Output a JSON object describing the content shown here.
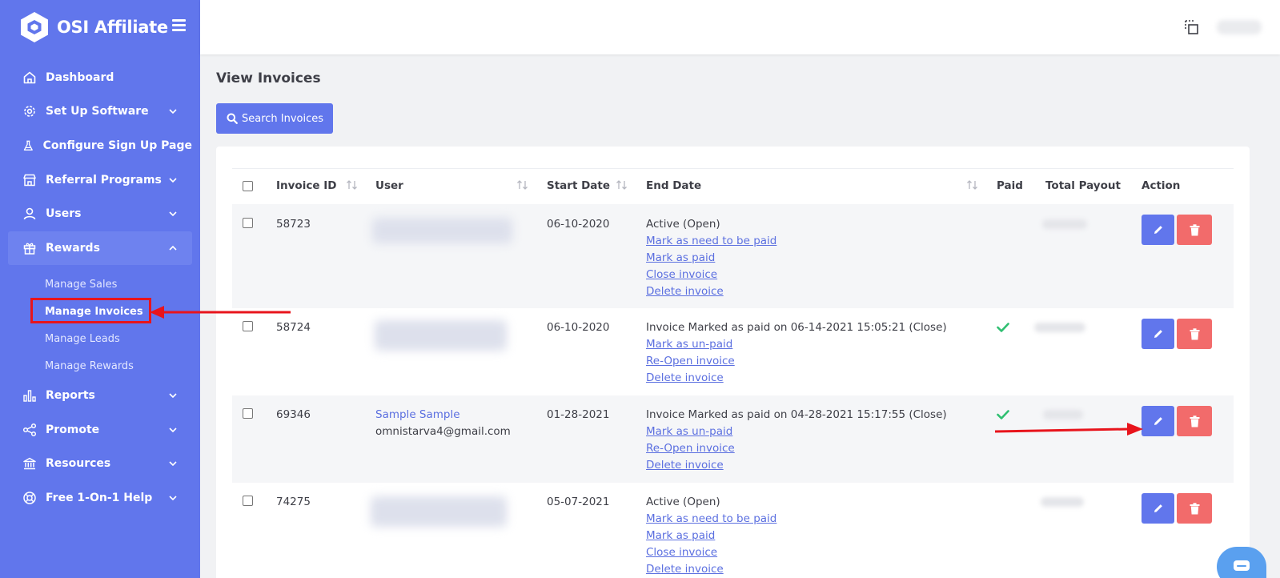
{
  "brand": {
    "name": "OSI Affiliate"
  },
  "sidebar": {
    "items": [
      {
        "label": "Dashboard",
        "icon": "home-icon",
        "chevron": false
      },
      {
        "label": "Set Up Software",
        "icon": "gear-icon",
        "chevron": true
      },
      {
        "label": "Configure Sign Up Page",
        "icon": "flask-icon",
        "chevron": false
      },
      {
        "label": "Referral Programs",
        "icon": "store-icon",
        "chevron": true
      },
      {
        "label": "Users",
        "icon": "user-icon",
        "chevron": true
      },
      {
        "label": "Rewards",
        "icon": "gift-icon",
        "chevron": true,
        "expanded": true
      },
      {
        "label": "Reports",
        "icon": "bar-chart-icon",
        "chevron": true
      },
      {
        "label": "Promote",
        "icon": "share-icon",
        "chevron": true
      },
      {
        "label": "Resources",
        "icon": "bank-icon",
        "chevron": true
      },
      {
        "label": "Free 1-On-1 Help",
        "icon": "lifebuoy-icon",
        "chevron": true
      }
    ],
    "rewards_sub": [
      {
        "label": "Manage Sales"
      },
      {
        "label": "Manage Invoices",
        "current": true
      },
      {
        "label": "Manage Leads"
      },
      {
        "label": "Manage Rewards"
      }
    ]
  },
  "page": {
    "title": "View Invoices",
    "search_button": "Search Invoices"
  },
  "table": {
    "headers": [
      "Invoice ID",
      "User",
      "Start Date",
      "End Date",
      "Paid",
      "Total Payout",
      "Action"
    ],
    "rows": [
      {
        "id": "58723",
        "user_name": "",
        "user_email": "",
        "start": "06-10-2020",
        "status": "Active (Open)",
        "paid": false,
        "links": [
          "Mark as need to be paid",
          "Mark as paid",
          "Close invoice",
          "Delete invoice"
        ]
      },
      {
        "id": "58724",
        "user_name": "",
        "user_email": "",
        "start": "06-10-2020",
        "status": "Invoice Marked as paid on 06-14-2021 15:05:21 (Close)",
        "paid": true,
        "links": [
          "Mark as un-paid",
          "Re-Open invoice",
          "Delete invoice"
        ]
      },
      {
        "id": "69346",
        "user_name": "Sample Sample",
        "user_email": "omnistarva4@gmail.com",
        "start": "01-28-2021",
        "status": "Invoice Marked as paid on 04-28-2021 15:17:55 (Close)",
        "paid": true,
        "links": [
          "Mark as un-paid",
          "Re-Open invoice",
          "Delete invoice"
        ]
      },
      {
        "id": "74275",
        "user_name": "",
        "user_email": "",
        "start": "05-07-2021",
        "status": "Active (Open)",
        "paid": false,
        "links": [
          "Mark as need to be paid",
          "Mark as paid",
          "Close invoice",
          "Delete invoice"
        ]
      }
    ]
  },
  "colors": {
    "sidebar": "#6176ec",
    "accent": "#6176ec",
    "danger": "#f26b6b",
    "success": "#2fbf71",
    "annotation": "#e8141c"
  }
}
